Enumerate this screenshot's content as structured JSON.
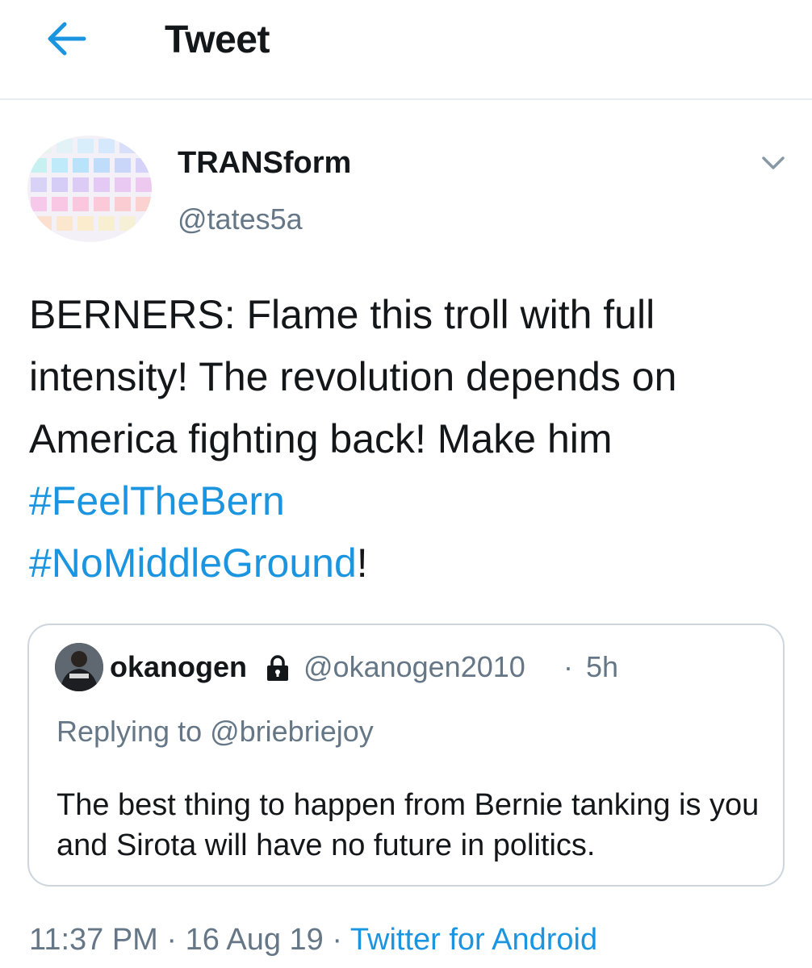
{
  "header": {
    "title": "Tweet",
    "back_icon": "arrow-left-icon"
  },
  "colors": {
    "accent": "#1b95e0",
    "secondary_text": "#657786",
    "border": "#ccd6dd",
    "divider": "#e6ecf0"
  },
  "tweet": {
    "display_name": "TRANSform",
    "handle": "@tates5a",
    "menu_icon": "chevron-down-icon",
    "text_plain_1": "BERNERS: Flame this troll with full intensity! The revolution depends on   America fighting back! Make him ",
    "hashtag_1": "#FeelTheBern",
    "hashtag_2": "#NoMiddleGround",
    "text_end": "!",
    "timestamp_time": "11:37 PM",
    "timestamp_date": "16 Aug 19",
    "separator": "·",
    "source": "Twitter for Android"
  },
  "quoted_tweet": {
    "display_name": "okanogen",
    "protected_icon": "lock-icon",
    "handle": "@okanogen2010",
    "separator": "·",
    "time_ago": "5h",
    "reply_prefix": "Replying to ",
    "reply_to": "@briebriejoy",
    "text": "The best thing to happen from Bernie tanking is you and Sirota will have no future in politics."
  }
}
